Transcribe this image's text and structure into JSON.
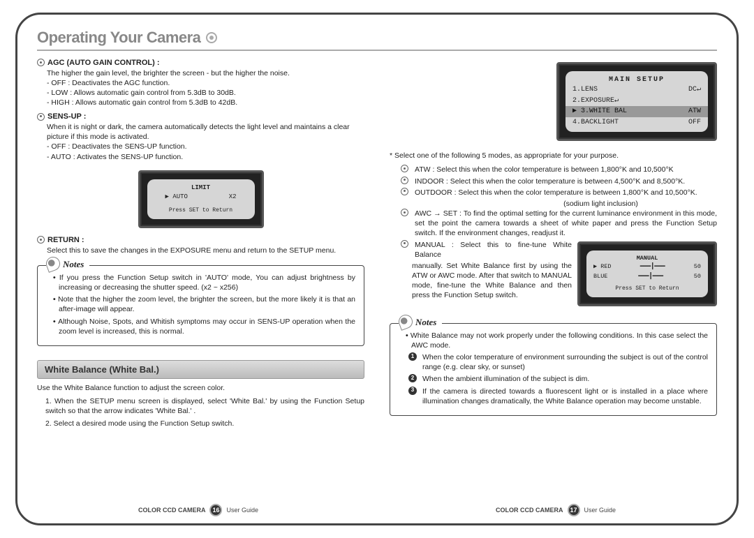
{
  "title": "Operating Your Camera",
  "left": {
    "agc": {
      "head": "AGC (AUTO GAIN CONTROL) :",
      "desc": "The higher the gain level, the brighter the screen - but the higher the noise.",
      "opt1": "- OFF : Deactivates the AGC function.",
      "opt2": "- LOW : Allows automatic gain control from 5.3dB to 30dB.",
      "opt3": "- HIGH : Allows automatic gain control from 5.3dB to 42dB."
    },
    "sensup": {
      "head": "SENS-UP :",
      "desc": "When it is night or dark, the camera automatically detects the light level and maintains a clear picture if this mode is activated.",
      "opt1": "- OFF : Deactivates the SENS-UP function.",
      "opt2": "- AUTO : Activates the SENS-UP function."
    },
    "limit_osd": {
      "title": "LIMIT",
      "row1_l": "▶ AUTO",
      "row1_r": "X2",
      "footer": "Press SET to Return"
    },
    "return": {
      "head": "RETURN :",
      "desc": "Select this to save the changes in the EXPOSURE menu and return to the SETUP menu."
    },
    "notes_label": "Notes",
    "notes": {
      "n1": "If you press the Function Setup switch in 'AUTO' mode, You can adjust brightness by increasing or decreasing the shutter speed. (x2 ~ x256)",
      "n2": "Note that the higher the zoom level, the brighter the screen, but the more likely it is that an after-image will appear.",
      "n3": "Although Noise, Spots, and Whitish symptoms may occur in SENS-UP operation when the zoom level is increased, this is normal."
    },
    "wb_header": "White Balance (White Bal.)",
    "wb_intro": "Use the White Balance function to adjust the screen color.",
    "wb_step1": "1. When the SETUP menu screen is displayed, select  'White Bal.' by using the Function Setup switch so that the arrow indicates 'White Bal.' .",
    "wb_step2": "2. Select a desired mode using the Function Setup switch."
  },
  "right": {
    "main_osd": {
      "title": "MAIN SETUP",
      "r1_l": "1.LENS",
      "r1_r": "DC↵",
      "r2_l": "2.EXPOSURE↵",
      "r2_r": "",
      "r3_l": "▶ 3.WHITE BAL",
      "r3_r": "ATW",
      "r4_l": "4.BACKLIGHT",
      "r4_r": "OFF"
    },
    "intro": "*  Select one of the following 5 modes, as appropriate for your purpose.",
    "atw": "ATW : Select this when the color temperature is between 1,800°K and 10,500°K",
    "indoor": "INDOOR : Select this when the color temperature is between 4,500°K and 8,500°K.",
    "outdoor": "OUTDOOR : Select this when the color temperature is between 1,800°K and 10,500°K.",
    "outdoor_sub": "(sodium light inclusion)",
    "awc": "AWC → SET : To find the optimal setting for the current luminance environment in this mode, set the point the camera towards a sheet of white paper and press the Function Setup switch. If the environment changes, readjust it.",
    "manual_head": "MANUAL : Select this to fine-tune White Balance",
    "manual_body": "manually. Set White Balance first by using the ATW or AWC mode. After that switch to MANUAL mode, fine-tune the White Balance and then press the Function Setup switch.",
    "manual_osd": {
      "title": "MANUAL",
      "red_l": "▶ RED",
      "red_r": "50",
      "blue_l": "  BLUE",
      "blue_r": "50",
      "footer": "Press SET to Return"
    },
    "notes_label": "Notes",
    "notes_intro": "White Balance may not work properly under the following conditions. In this case select the AWC mode.",
    "nn1": "When the color temperature of environment surrounding the subject is out of the control range (e.g. clear sky, or sunset)",
    "nn2": "When the ambient illumination of the subject is dim.",
    "nn3": "If the camera is directed towards a fluorescent light or is installed in a place where illumination changes dramatically, the White Balance operation may become unstable."
  },
  "footer": {
    "label_left": "COLOR CCD CAMERA",
    "page_left": "16",
    "guide": "User Guide",
    "page_right": "17"
  }
}
